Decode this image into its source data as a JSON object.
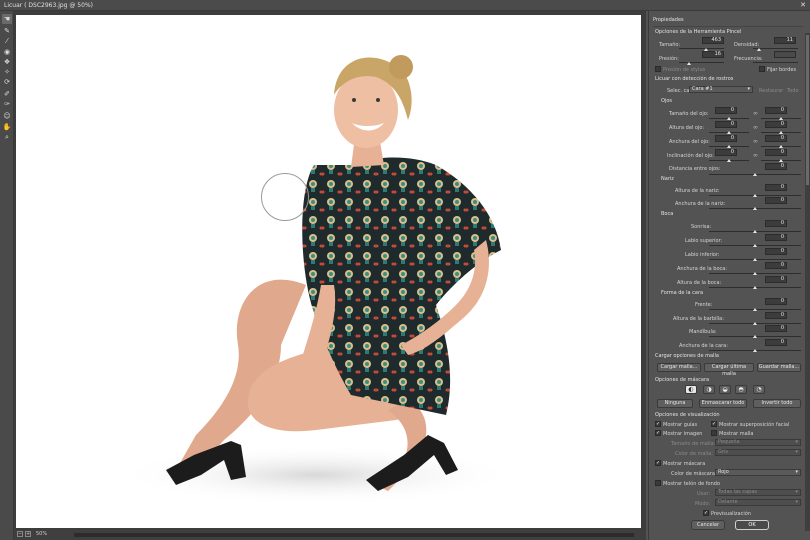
{
  "window": {
    "title": "Licuar ( DSC2963.jpg @ 50%)",
    "close_glyph": "✕"
  },
  "tools": [
    {
      "name": "forward-warp-tool",
      "glyph": "☚"
    },
    {
      "name": "reconstruct-tool",
      "glyph": "✎"
    },
    {
      "name": "smooth-tool",
      "glyph": "⁄"
    },
    {
      "name": "twirl-tool",
      "glyph": "◉"
    },
    {
      "name": "pucker-tool",
      "glyph": "❖"
    },
    {
      "name": "bloat-tool",
      "glyph": "✧"
    },
    {
      "name": "push-left-tool",
      "glyph": "⟳"
    },
    {
      "name": "freeze-mask-tool",
      "glyph": "✐"
    },
    {
      "name": "thaw-mask-tool",
      "glyph": "✑"
    },
    {
      "name": "face-tool",
      "glyph": "☺"
    },
    {
      "name": "hand-tool",
      "glyph": "✋"
    },
    {
      "name": "zoom-tool",
      "glyph": "⌕"
    }
  ],
  "status": {
    "zoom": "50%",
    "minus": "−",
    "plus": "+"
  },
  "panel": {
    "title": "Propiedades",
    "brush": {
      "header": "Opciones de la Herramienta Pincel",
      "size_label": "Tamaño:",
      "size_value": "463",
      "density_label": "Densidad:",
      "density_value": "11",
      "pressure_label": "Presión:",
      "pressure_value": "16",
      "rate_label": "Frecuencia:",
      "rate_value": "",
      "stylus_label": "Presión de stylus",
      "pin_edges_label": "Fijar bordes"
    },
    "face": {
      "header": "Licuar con detección de rostros",
      "select_label": "Selec. cara:",
      "select_value": "Cara #1",
      "reset_label": "Restaurar",
      "all_label": "Todo",
      "eyes": {
        "header": "Ojos",
        "rows": [
          {
            "label": "Tamaño del ojo:",
            "left": "0",
            "right": "0"
          },
          {
            "label": "Altura del ojo:",
            "left": "0",
            "right": "0"
          },
          {
            "label": "Anchura del ojo:",
            "left": "0",
            "right": "0"
          },
          {
            "label": "Inclinación del ojo:",
            "left": "0",
            "right": "0"
          }
        ],
        "distance_label": "Distancia entre ojos:",
        "distance_value": "0"
      },
      "nose": {
        "header": "Nariz",
        "rows": [
          {
            "label": "Altura de la nariz:",
            "value": "0"
          },
          {
            "label": "Anchura de la nariz:",
            "value": "0"
          }
        ]
      },
      "mouth": {
        "header": "Boca",
        "rows": [
          {
            "label": "Sonrisa:",
            "value": "0"
          },
          {
            "label": "Labio superior:",
            "value": "0"
          },
          {
            "label": "Labio inferior:",
            "value": "0"
          },
          {
            "label": "Anchura de la boca:",
            "value": "0"
          },
          {
            "label": "Altura de la boca:",
            "value": "0"
          }
        ]
      },
      "face_shape": {
        "header": "Forma de la cara",
        "rows": [
          {
            "label": "Frente:",
            "value": "0"
          },
          {
            "label": "Altura de la barbilla:",
            "value": "0"
          },
          {
            "label": "Mandíbula:",
            "value": "0"
          },
          {
            "label": "Anchura de la cara:",
            "value": "0"
          }
        ]
      }
    },
    "mesh": {
      "header": "Cargar opciones de malla",
      "load_mesh": "Cargar malla...",
      "load_last": "Cargar última malla",
      "save_mesh": "Guardar malla..."
    },
    "mask": {
      "header": "Opciones de máscara",
      "none": "Ninguna",
      "mask_all": "Enmascarar todo",
      "invert_all": "Invertir todo"
    },
    "view": {
      "header": "Opciones de visualización",
      "show_guides": "Mostrar guías",
      "show_face_overlay": "Mostrar superposición facial",
      "show_image": "Mostrar imagen",
      "show_mesh": "Mostrar malla",
      "mesh_size_label": "Tamaño de malla:",
      "mesh_size_value": "Pequeña",
      "mesh_color_label": "Color de malla:",
      "mesh_color_value": "Gris",
      "show_mask": "Mostrar máscara",
      "mask_color_label": "Color de máscara:",
      "mask_color_value": "Rojo",
      "show_backdrop": "Mostrar telón de fondo",
      "use_label": "Usar:",
      "use_value": "Todas las capas",
      "mode_label": "Modo:",
      "mode_value": "Delante",
      "opacity_label": "Opacidad:",
      "opacity_value": "50"
    },
    "preview_label": "Previsualización",
    "cancel": "Cancelar",
    "ok": "OK"
  },
  "colors": {
    "canvas": "#ffffff",
    "panel": "#535353",
    "accent": "#2d6fd6"
  }
}
